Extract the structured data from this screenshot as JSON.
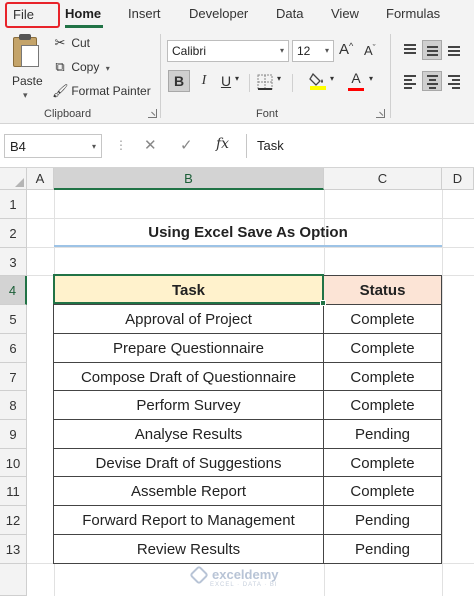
{
  "ribbon": {
    "tabs": [
      "File",
      "Home",
      "Insert",
      "Developer",
      "Data",
      "View",
      "Formulas"
    ],
    "clipboard": {
      "paste": "Paste",
      "cut": "Cut",
      "copy": "Copy",
      "format_painter": "Format Painter",
      "label": "Clipboard"
    },
    "font": {
      "name": "Calibri",
      "size": "12",
      "grow": "A",
      "shrink": "A",
      "bold": "B",
      "italic": "I",
      "underline": "U",
      "font_color_glyph": "A",
      "label": "Font"
    },
    "colors": {
      "highlight": "#ffff00",
      "font_color": "#ff0000",
      "accent": "#217346"
    }
  },
  "formula_bar": {
    "name_box": "B4",
    "fx": "fx",
    "value": "Task"
  },
  "grid": {
    "columns": [
      "A",
      "B",
      "C",
      "D"
    ],
    "rows": [
      "1",
      "2",
      "3",
      "4",
      "5",
      "6",
      "7",
      "8",
      "9",
      "10",
      "11",
      "12",
      "13"
    ]
  },
  "sheet": {
    "title": "Using Excel Save As Option",
    "table": {
      "headers": [
        "Task",
        "Status"
      ],
      "rows": [
        [
          "Approval of Project",
          "Complete"
        ],
        [
          "Prepare Questionnaire",
          "Complete"
        ],
        [
          "Compose Draft of Questionnaire",
          "Complete"
        ],
        [
          "Perform Survey",
          "Complete"
        ],
        [
          "Analyse Results",
          "Pending"
        ],
        [
          "Devise Draft of Suggestions",
          "Complete"
        ],
        [
          "Assemble Report",
          "Complete"
        ],
        [
          "Forward Report to Management",
          "Pending"
        ],
        [
          "Review Results",
          "Pending"
        ]
      ]
    }
  },
  "watermark": {
    "name": "exceldemy",
    "tagline": "EXCEL · DATA · BI"
  }
}
